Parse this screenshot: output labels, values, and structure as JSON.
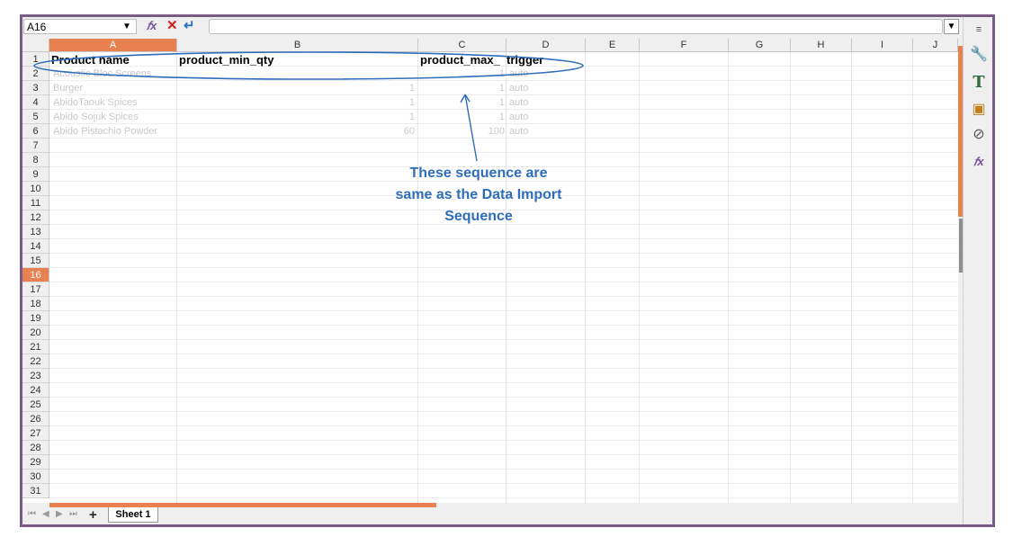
{
  "formula_bar": {
    "name_box": "A16",
    "formula_value": ""
  },
  "columns": [
    "A",
    "B",
    "C",
    "D",
    "E",
    "F",
    "G",
    "H",
    "I",
    "J"
  ],
  "selected_column": "A",
  "rows": [
    "1",
    "2",
    "3",
    "4",
    "5",
    "6",
    "7",
    "8",
    "9",
    "10",
    "11",
    "12",
    "13",
    "14",
    "15",
    "16",
    "17",
    "18",
    "19",
    "20",
    "21",
    "22",
    "23",
    "24",
    "25",
    "26",
    "27",
    "28",
    "29",
    "30",
    "31"
  ],
  "selected_row": "16",
  "header_row": {
    "a": "Product name",
    "b": "product_min_qty",
    "c": "product_max_",
    "d": "trigger"
  },
  "data_rows": [
    {
      "a": "Acoustic Bloc Screens",
      "b": "",
      "c": "1",
      "d": "auto"
    },
    {
      "a": "Burger",
      "b": "1",
      "c": "1",
      "d": "auto"
    },
    {
      "a": "AbidoTaouk Spices",
      "b": "1",
      "c": "1",
      "d": "auto"
    },
    {
      "a": "Abido Sojuk Spices",
      "b": "1",
      "c": "1",
      "d": "auto"
    },
    {
      "a": "Abido Pistachio Powder",
      "b": "60",
      "c": "100",
      "d": "auto"
    }
  ],
  "annotation": {
    "line1": "These sequence are",
    "line2": "same as the Data Import",
    "line3": "Sequence",
    "color": "#2e6dbb"
  },
  "sheet_tabs": {
    "active": "Sheet 1"
  },
  "icons": {
    "function_wizard": "function-wizard-icon",
    "cancel": "cancel-icon",
    "accept": "accept-icon",
    "sidebar": [
      "properties-icon",
      "styles-icon",
      "gallery-icon",
      "navigator-icon",
      "functions-icon"
    ]
  }
}
